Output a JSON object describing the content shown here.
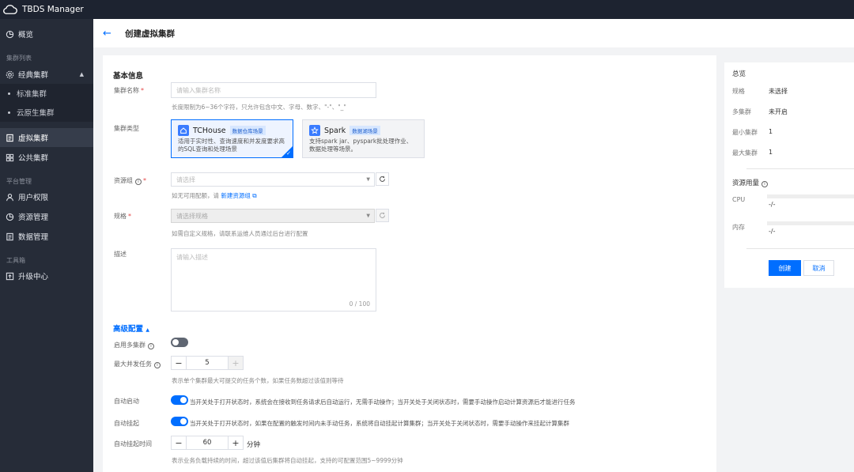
{
  "app": {
    "title": "TBDS Manager"
  },
  "sidebar": {
    "overview": "概览",
    "group_clusters": "集群列表",
    "classic": "经典集群",
    "standard": "标准集群",
    "cloud_native": "云原生集群",
    "virtual": "虚拟集群",
    "public": "公共集群",
    "group_platform": "平台管理",
    "user_perm": "用户权限",
    "resource_mgmt": "资源管理",
    "data_mgmt": "数据管理",
    "group_tools": "工具箱",
    "upgrade": "升级中心"
  },
  "header": {
    "back": "←",
    "title": "创建虚拟集群"
  },
  "form": {
    "basic_title": "基本信息",
    "name_label": "集群名称",
    "name_placeholder": "请输入集群名称",
    "name_hint": "长度限制为6~36个字符，只允许包含中文、字母、数字、\"-\"、\"_\"",
    "type_label": "集群类型",
    "tc_name": "TCHouse",
    "tc_badge": "数据仓库场景",
    "tc_desc": "适用于实时性、查询速度和并发度要求高的SQL查询和处理场景",
    "spark_name": "Spark",
    "spark_badge": "数据湖场景",
    "spark_desc": "支持spark jar、pyspark批处理作业、数据处理等场景。",
    "rg_label": "资源组",
    "rg_placeholder": "请选择",
    "rg_hint_prefix": "如无可用配额，请",
    "rg_hint_link": "新建资源组",
    "spec_label": "规格",
    "spec_placeholder": "请选择规格",
    "spec_hint": "如需自定义规格，请联系运维人员通过后台进行配置",
    "desc_label": "描述",
    "desc_placeholder": "请输入描述",
    "desc_counter": "0 / 100",
    "adv_title": "高级配置",
    "multi_label": "启用多集群",
    "multi_on": false,
    "maxtask_label": "最大并发任务",
    "maxtask_value": "5",
    "maxtask_hint": "表示单个集群最大可提交的任务个数，如果任务数超过该值则等待",
    "autostart_label": "自动启动",
    "autostart_on": true,
    "autostart_desc": "当开关处于打开状态时，系统会在接收到任务请求后自动运行，无需手动操作；当开关处于关闭状态时，需要手动操作启动计算资源后才能进行任务",
    "autosuspend_label": "自动挂起",
    "autosuspend_on": true,
    "autosuspend_desc": "当开关处于打开状态时，如果在配置的触发时间内未手动任务，系统将自动挂起计算集群；当开关处于关闭状态时，需要手动操作来挂起计算集群",
    "suspendtime_label": "自动挂起时间",
    "suspendtime_value": "60",
    "suspendtime_unit": "分钟",
    "suspendtime_hint": "表示业务负载持续的时间，超过该值后集群将自动挂起，支持的可配置范围5~9999分钟",
    "minus": "−",
    "plus": "+"
  },
  "summary": {
    "title": "总览",
    "spec_label": "规格",
    "spec_val": "未选择",
    "multi_label": "多集群",
    "multi_val": "未开启",
    "min_label": "最小集群",
    "min_val": "1",
    "max_label": "最大集群",
    "max_val": "1",
    "usage_title": "资源用量",
    "cpu_label": "CPU",
    "cpu_val": "-/-",
    "mem_label": "内存",
    "mem_val": "-/-",
    "create": "创建",
    "cancel": "取消"
  }
}
